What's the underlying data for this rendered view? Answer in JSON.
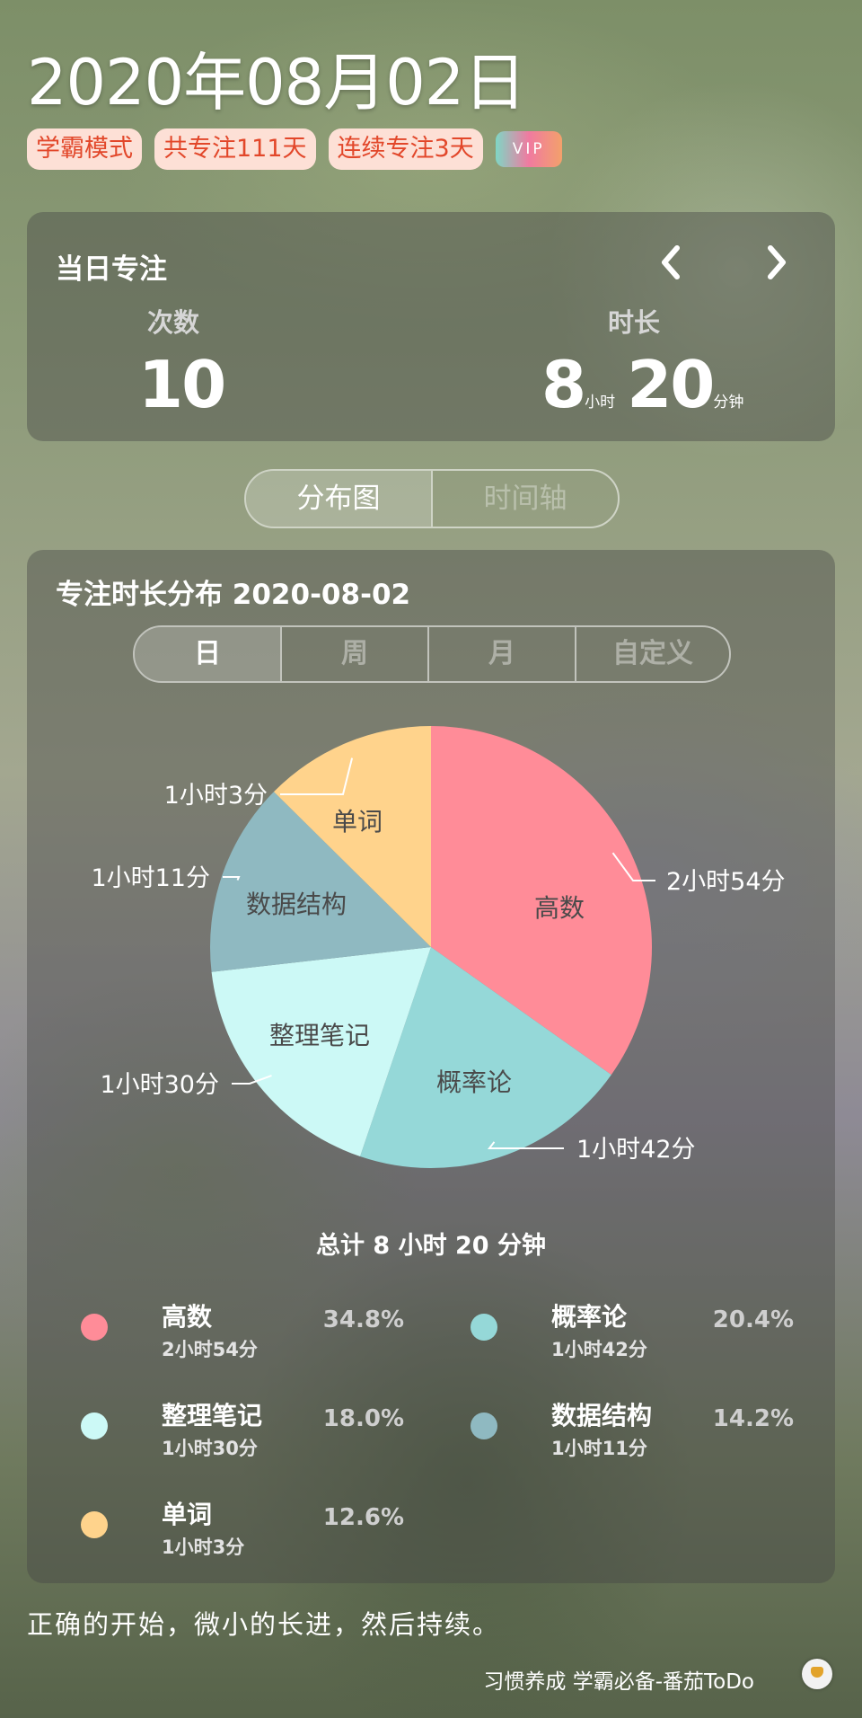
{
  "header": {
    "date_title": "2020年08月02日",
    "tags": [
      "学霸模式",
      "共专注111天",
      "连续专注3天"
    ],
    "vip": "VIP"
  },
  "daily": {
    "title": "当日专注",
    "count_label": "次数",
    "count_value": "10",
    "duration_label": "时长",
    "hours": "8",
    "hours_unit": "小时",
    "minutes": "20",
    "minutes_unit": "分钟"
  },
  "view_tabs": [
    "分布图",
    "时间轴"
  ],
  "distribution": {
    "title": "专注时长分布  2020-08-02",
    "period_tabs": [
      "日",
      "周",
      "月",
      "自定义"
    ],
    "total": "总计 8 小时 20 分钟"
  },
  "chart_data": {
    "type": "pie",
    "title": "专注时长分布  2020-08-02",
    "slices": [
      {
        "name": "高数",
        "label": "2小时54分",
        "minutes": 174,
        "percent": "34.8%",
        "color": "#ff8c98"
      },
      {
        "name": "概率论",
        "label": "1小时42分",
        "minutes": 102,
        "percent": "20.4%",
        "color": "#95d8d8"
      },
      {
        "name": "整理笔记",
        "label": "1小时30分",
        "minutes": 90,
        "percent": "18.0%",
        "color": "#ccf9f6"
      },
      {
        "name": "数据结构",
        "label": "1小时11分",
        "minutes": 71,
        "percent": "14.2%",
        "color": "#8fb9c1"
      },
      {
        "name": "单词",
        "label": "1小时3分",
        "minutes": 63,
        "percent": "12.6%",
        "color": "#ffd38c"
      }
    ]
  },
  "quote": "正确的开始，微小的长进，然后持续。",
  "footer": "习惯养成 学霸必备-番茄ToDo"
}
